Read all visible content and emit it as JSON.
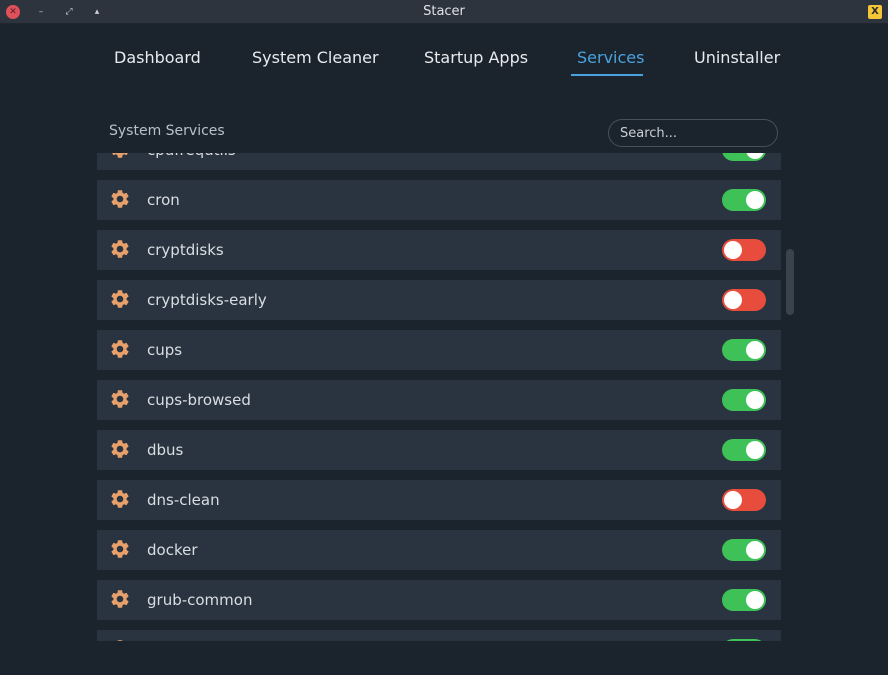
{
  "window": {
    "title": "Stacer",
    "badge": "X"
  },
  "tabs": [
    {
      "label": "Dashboard"
    },
    {
      "label": "System Cleaner"
    },
    {
      "label": "Startup Apps"
    },
    {
      "label": "Services",
      "active": true
    },
    {
      "label": "Uninstaller"
    }
  ],
  "section": {
    "title": "System Services"
  },
  "search": {
    "placeholder": "Search...",
    "value": ""
  },
  "colors": {
    "accent": "#4aa3df",
    "toggle_on": "#3ec257",
    "toggle_off": "#e74c3c",
    "gear": "#e8a06a"
  },
  "services": [
    {
      "name": "cpufrequtils",
      "enabled": true,
      "partial": true
    },
    {
      "name": "cron",
      "enabled": true
    },
    {
      "name": "cryptdisks",
      "enabled": false
    },
    {
      "name": "cryptdisks-early",
      "enabled": false
    },
    {
      "name": "cups",
      "enabled": true
    },
    {
      "name": "cups-browsed",
      "enabled": true
    },
    {
      "name": "dbus",
      "enabled": true
    },
    {
      "name": "dns-clean",
      "enabled": false
    },
    {
      "name": "docker",
      "enabled": true
    },
    {
      "name": "grub-common",
      "enabled": true
    },
    {
      "name": "",
      "enabled": true,
      "partial": true
    }
  ]
}
